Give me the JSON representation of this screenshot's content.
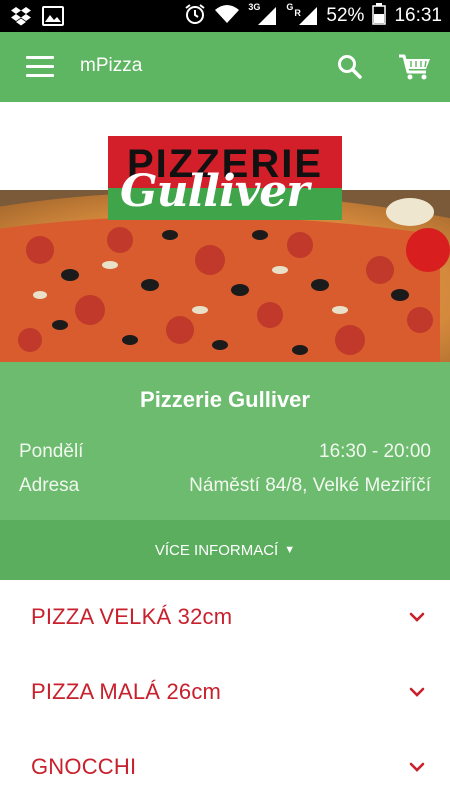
{
  "status_bar": {
    "net_3g": "3G",
    "net_g": "G",
    "net_r": "R",
    "battery": "52%",
    "time": "16:31",
    "icons": [
      "dropbox-icon",
      "image-icon",
      "alarm-icon",
      "wifi-icon",
      "signal-icon",
      "signal-icon",
      "battery-icon"
    ]
  },
  "app_bar": {
    "title": "mPizza",
    "icons": [
      "menu-icon",
      "search-icon",
      "cart-icon"
    ]
  },
  "hero": {
    "logo_top": "PIZZERIE",
    "logo_script": "Gulliver"
  },
  "info": {
    "name": "Pizzerie Gulliver",
    "rows": [
      {
        "label": "Pondělí",
        "value": "16:30 - 20:00"
      },
      {
        "label": "Adresa",
        "value": "Náměstí 84/8, Velké Meziříčí"
      }
    ]
  },
  "more_info": {
    "label": "VÍCE INFORMACÍ",
    "arrow": "▼"
  },
  "categories": [
    {
      "label": "PIZZA VELKÁ 32cm"
    },
    {
      "label": "PIZZA MALÁ 26cm"
    },
    {
      "label": "GNOCCHI"
    }
  ],
  "colors": {
    "primary": "#5eb562",
    "info_panel": "#6cbb6e",
    "accent_red": "#c8202c"
  }
}
